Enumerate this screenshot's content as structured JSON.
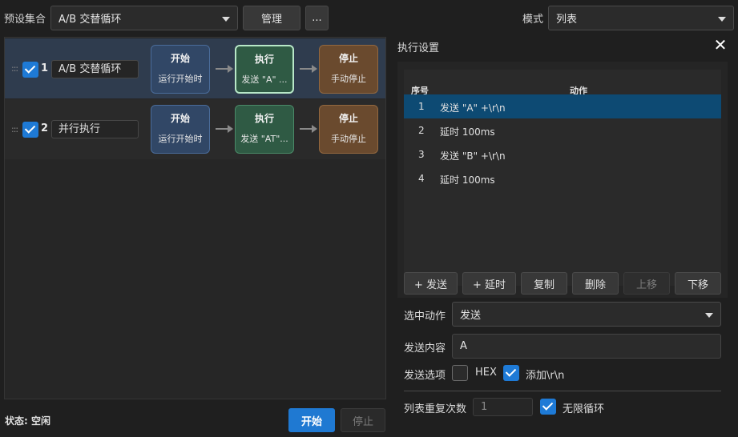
{
  "topbar": {
    "preset_label": "预设集合",
    "preset_value": "A/B 交替循环",
    "manage_label": "管理",
    "more_label": "...",
    "mode_label": "模式",
    "mode_value": "列表"
  },
  "sequences": [
    {
      "num": "1",
      "name": "A/B 交替循环",
      "checked": true,
      "selected": true,
      "start": {
        "title": "开始",
        "sub": "运行开始时"
      },
      "exec": {
        "title": "执行",
        "sub": "发送 \"A\" ..."
      },
      "stop": {
        "title": "停止",
        "sub": "手动停止"
      }
    },
    {
      "num": "2",
      "name": "并行执行",
      "checked": true,
      "selected": false,
      "start": {
        "title": "开始",
        "sub": "运行开始时"
      },
      "exec": {
        "title": "执行",
        "sub": "发送 \"AT\"..."
      },
      "stop": {
        "title": "停止",
        "sub": "手动停止"
      }
    }
  ],
  "panel": {
    "title": "执行设置",
    "close_glyph": "✕",
    "table": {
      "headers": [
        "序号",
        "动作"
      ],
      "rows": [
        {
          "idx": "1",
          "action": "发送 \"A\" +\\r\\n",
          "selected": true
        },
        {
          "idx": "2",
          "action": "延时 100ms",
          "selected": false
        },
        {
          "idx": "3",
          "action": "发送 \"B\" +\\r\\n",
          "selected": false
        },
        {
          "idx": "4",
          "action": "延时 100ms",
          "selected": false
        }
      ]
    },
    "buttons": {
      "add_send": "+ 发送",
      "add_delay": "+ 延时",
      "copy": "复制",
      "delete": "删除",
      "move_up": "上移",
      "move_down": "下移"
    },
    "selected_action_label": "选中动作",
    "selected_action_value": "发送",
    "send_content_label": "发送内容",
    "send_content_value": "A",
    "send_options_label": "发送选项",
    "hex_label": "HEX",
    "hex_checked": false,
    "append_crlf_label": "添加\\r\\n",
    "append_crlf_checked": true,
    "repeat_label": "列表重复次数",
    "repeat_value": "1",
    "infinite_label": "无限循环",
    "infinite_checked": true
  },
  "footer": {
    "status_text": "状态: 空闲",
    "start_label": "开始",
    "stop_label": "停止"
  },
  "colors": {
    "accent": "#1f79d2",
    "start_node": "#314766",
    "exec_node": "#2f5a44",
    "stop_node": "#6a4a2e",
    "selected_row": "#0d4a73"
  }
}
